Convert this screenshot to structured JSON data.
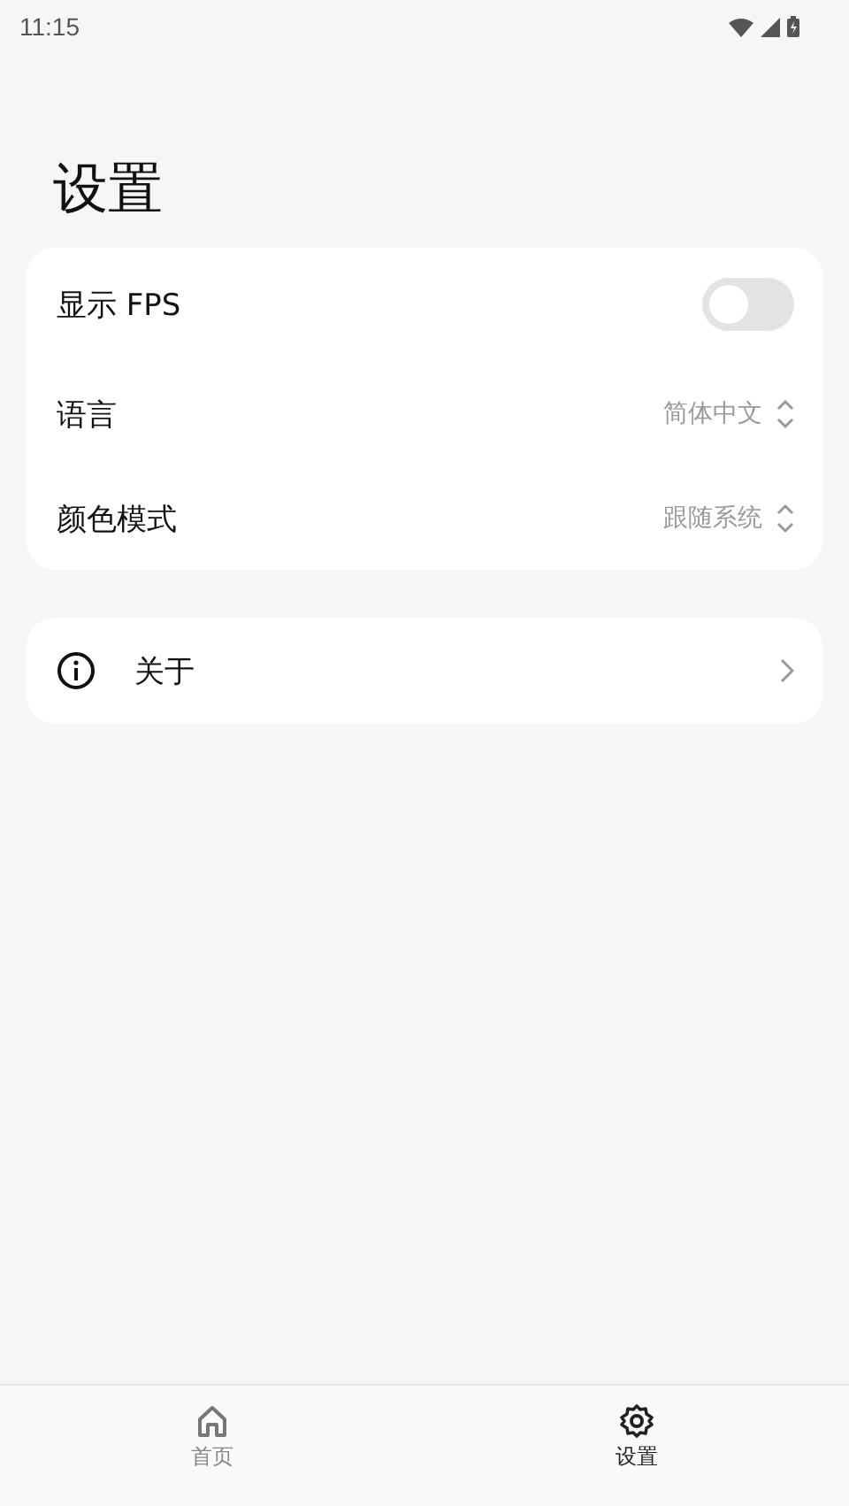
{
  "status_bar": {
    "time": "11:15"
  },
  "title": "设置",
  "groups": [
    {
      "items": [
        {
          "kind": "toggle",
          "label": "显示 FPS",
          "on": false
        },
        {
          "kind": "select",
          "label": "语言",
          "value": "简体中文"
        },
        {
          "kind": "select",
          "label": "颜色模式",
          "value": "跟随系统"
        }
      ]
    },
    {
      "items": [
        {
          "kind": "link",
          "label": "关于"
        }
      ]
    }
  ],
  "nav": [
    {
      "label": "首页",
      "selected": false
    },
    {
      "label": "设置",
      "selected": true
    }
  ]
}
